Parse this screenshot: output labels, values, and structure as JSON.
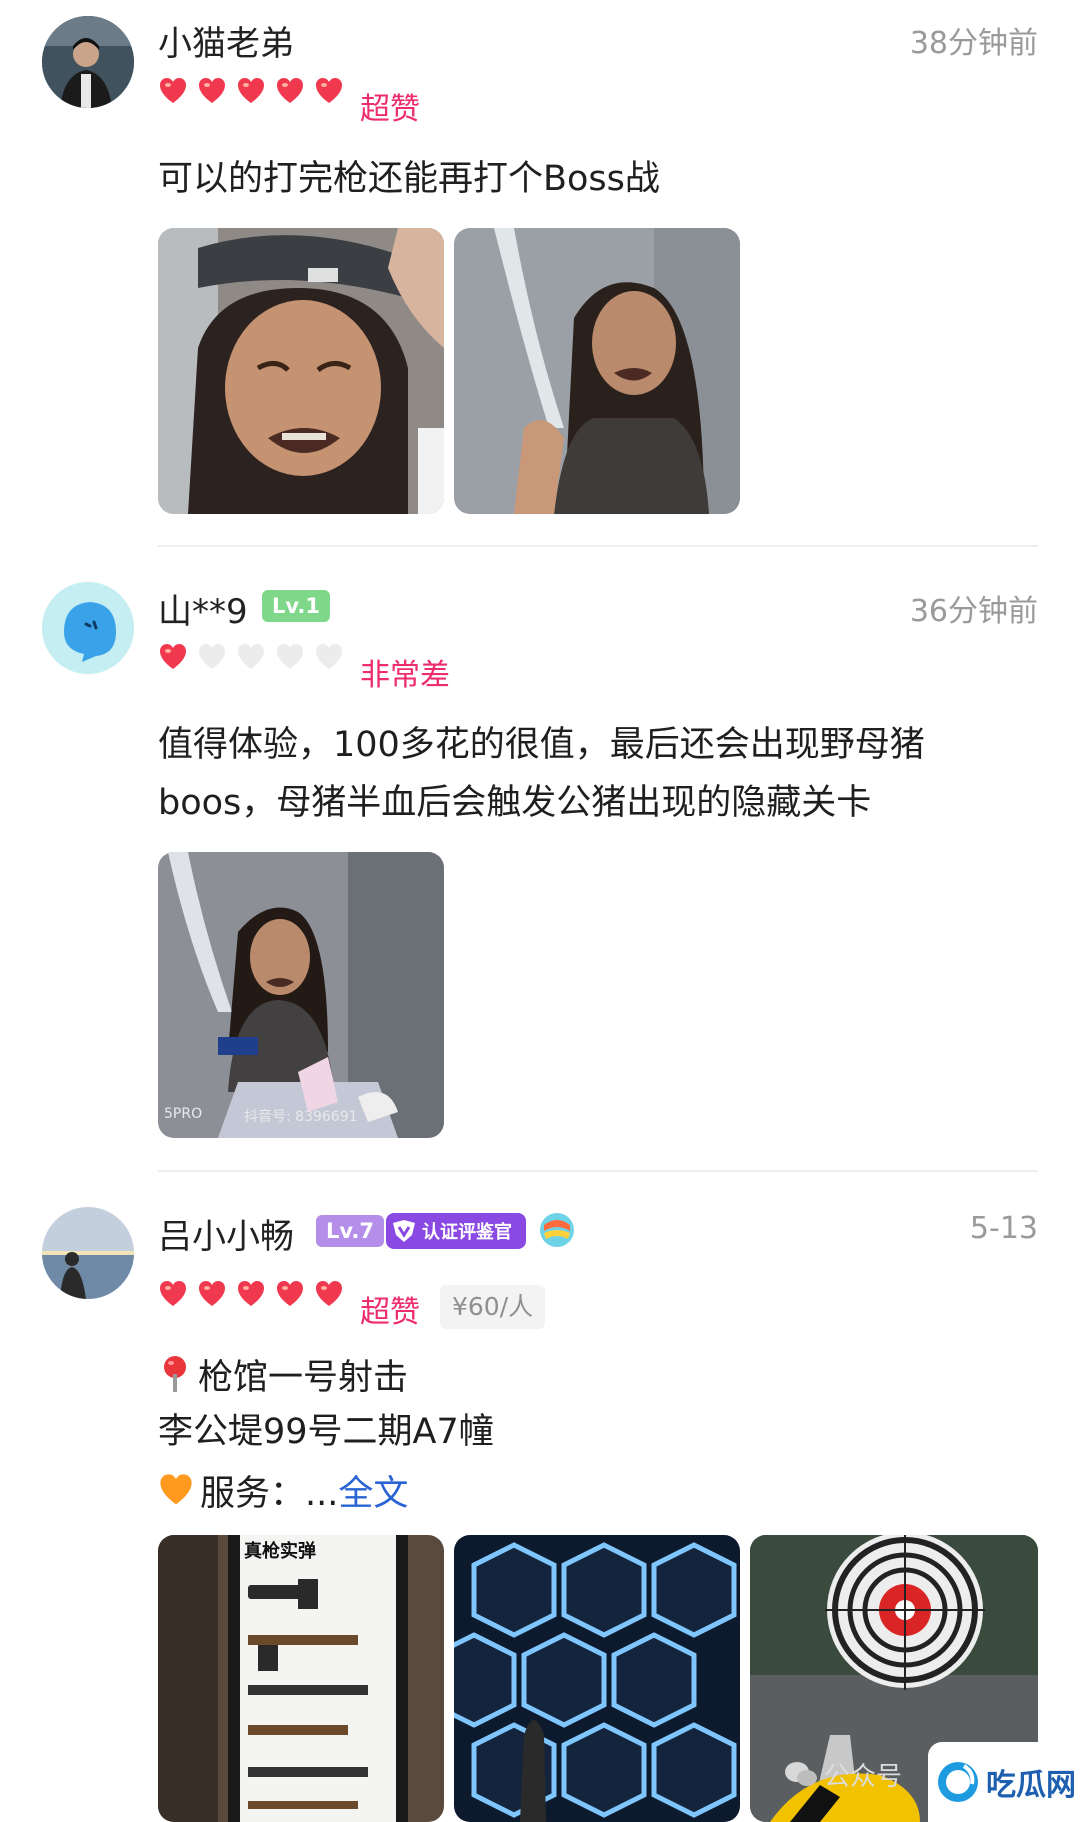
{
  "reviews": [
    {
      "name": "小猫老弟",
      "time": "38分钟前",
      "rating_label": "超赞",
      "rating": 5,
      "lines": [
        "可以的打完枪还能再打个Boss战"
      ]
    },
    {
      "name": "山**9",
      "level": "Lv.1",
      "time": "36分钟前",
      "rating_label": "非常差",
      "rating": 1,
      "lines": [
        "值得体验，100多花的很值，最后还会出现野母猪",
        "boos，母猪半血后会触发公猪出现的隐藏关卡"
      ],
      "photo_caption_left": "5PRO",
      "photo_caption_mid": "抖音号: 8396691"
    },
    {
      "name": "吕小小畅",
      "level": "Lv.7",
      "verified_badge": "认证评鉴官",
      "time": "5-13",
      "rating_label": "超赞",
      "rating": 5,
      "price": "¥60/人",
      "venue": "枪馆一号射击",
      "address": "李公堤99号二期A7幢",
      "service_prefix": "服务：...",
      "read_more": "全文",
      "photo_sign_title": "真枪实弹"
    }
  ],
  "watermark": {
    "wechat_label": "公众号",
    "site_label": "吃瓜网"
  },
  "colors": {
    "heart_active": "#f0394f",
    "heart_inactive": "#e6e6e6",
    "rating_text": "#ee2d6c",
    "level_lv1": "#7fd88a",
    "level_lv7": "#b48ee8",
    "verified": "#8a49e3",
    "link": "#2a63d3"
  }
}
